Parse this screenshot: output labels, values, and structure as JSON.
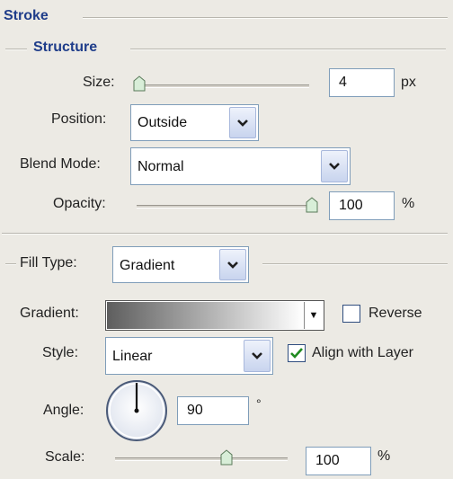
{
  "stroke": {
    "title": "Stroke"
  },
  "structure": {
    "title": "Structure",
    "size": {
      "label": "Size:",
      "value": "4",
      "unit": "px",
      "slider_fraction": 0.04
    },
    "position": {
      "label": "Position:",
      "value": "Outside"
    },
    "blend_mode": {
      "label": "Blend Mode:",
      "value": "Normal"
    },
    "opacity": {
      "label": "Opacity:",
      "value": "100",
      "unit": "%",
      "slider_fraction": 1.0
    }
  },
  "fill": {
    "fill_type": {
      "label": "Fill Type:",
      "value": "Gradient"
    },
    "gradient": {
      "label": "Gradient:",
      "colors": [
        "#5e5e5e",
        "#ffffff"
      ]
    },
    "reverse": {
      "label": "Reverse",
      "checked": false
    },
    "style": {
      "label": "Style:",
      "value": "Linear"
    },
    "align_with_layer": {
      "label": "Align with Layer",
      "checked": true
    },
    "angle": {
      "label": "Angle:",
      "value": "90",
      "unit": "°"
    },
    "scale": {
      "label": "Scale:",
      "value": "100",
      "unit": "%",
      "slider_fraction": 0.68
    }
  },
  "colors": {
    "accent_title": "#1f3d8a",
    "check_green": "#1f8a1f"
  }
}
